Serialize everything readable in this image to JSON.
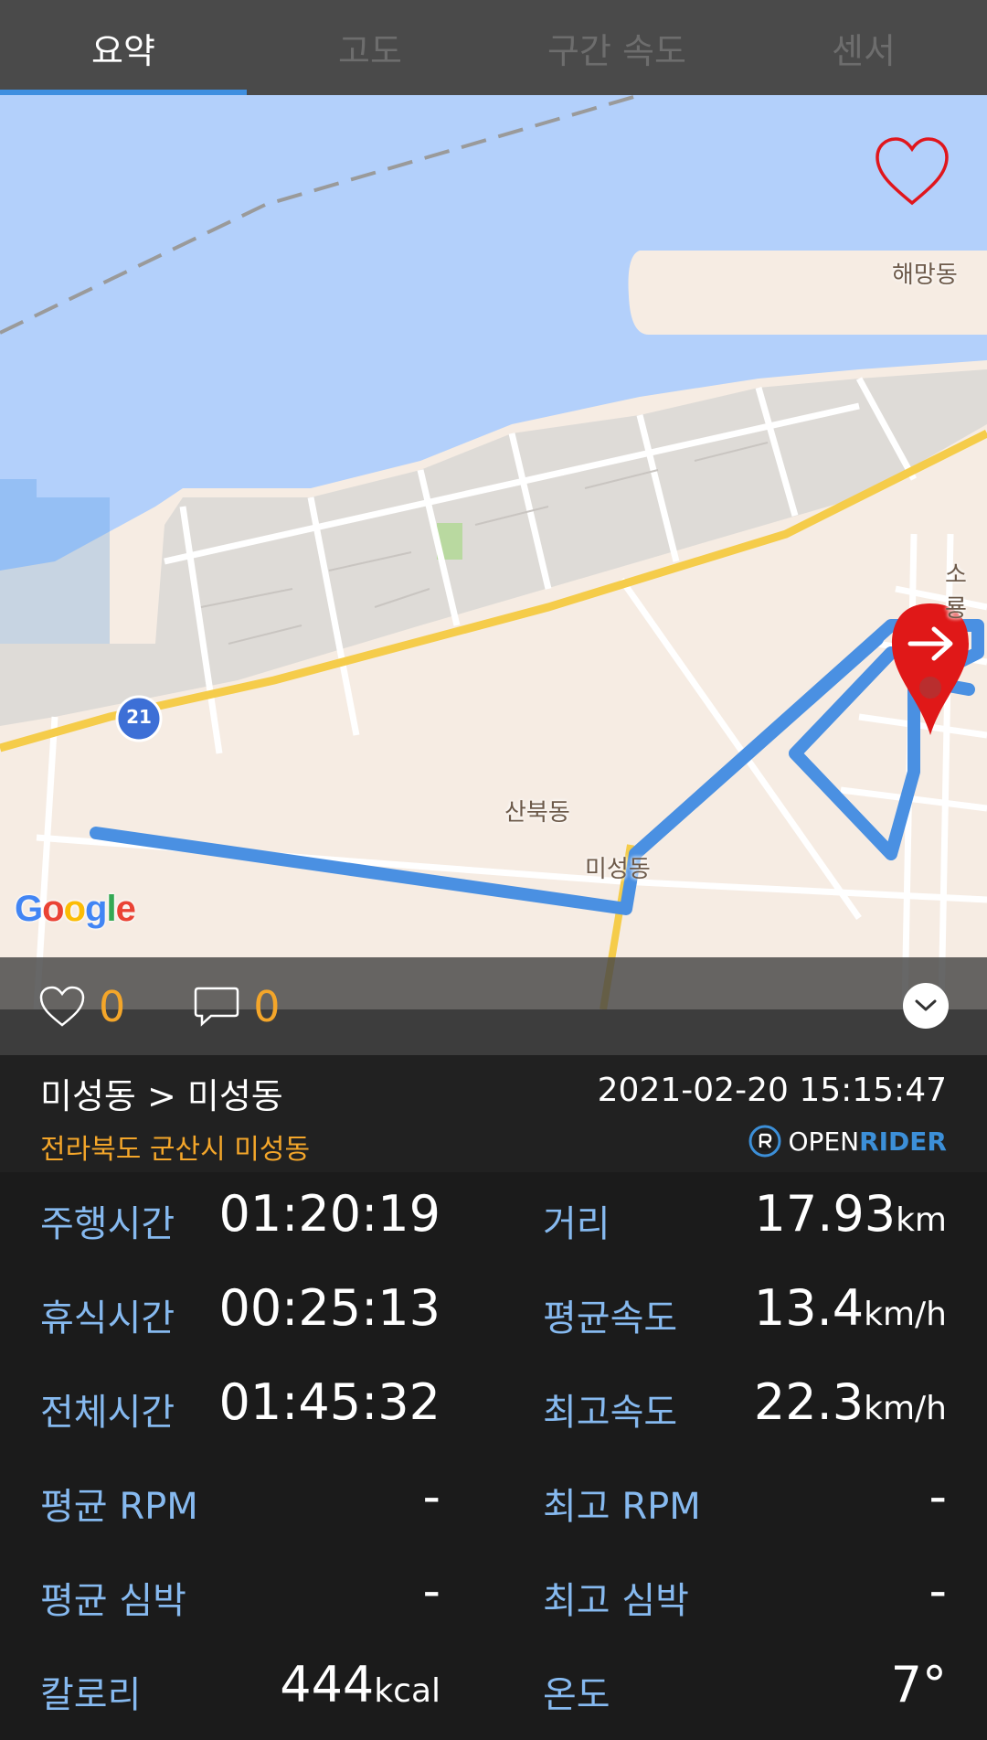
{
  "tabs": [
    {
      "label": "요약",
      "active": true
    },
    {
      "label": "고도",
      "active": false
    },
    {
      "label": "구간 속도",
      "active": false
    },
    {
      "label": "센서",
      "active": false
    }
  ],
  "map": {
    "labels": {
      "haemang": "해망동",
      "sanbuk": "산북동",
      "miseong": "미성동",
      "soryong": "소룡",
      "road_number": "21"
    },
    "provider_logo": {
      "G": "G",
      "o1": "o",
      "o2": "o",
      "g": "g",
      "l": "l",
      "e": "e"
    },
    "route_color": "#4a90e2",
    "marker_color": "#e01818"
  },
  "social": {
    "likes": "0",
    "comments": "0"
  },
  "route": {
    "title": "미성동 > 미성동",
    "subtitle": "전라북도 군산시 미성동",
    "datetime": "2021-02-20 15:15:47",
    "brand_open": "OPEN",
    "brand_rider": "RIDER"
  },
  "stats": [
    {
      "left_label": "주행시간",
      "left_value": "01:20:19",
      "left_unit": "",
      "right_label": "거리",
      "right_value": "17.93",
      "right_unit": "km"
    },
    {
      "left_label": "휴식시간",
      "left_value": "00:25:13",
      "left_unit": "",
      "right_label": "평균속도",
      "right_value": "13.4",
      "right_unit": "km/h"
    },
    {
      "left_label": "전체시간",
      "left_value": "01:45:32",
      "left_unit": "",
      "right_label": "최고속도",
      "right_value": "22.3",
      "right_unit": "km/h"
    },
    {
      "left_label": "평균 RPM",
      "left_value": "-",
      "left_unit": "",
      "right_label": "최고 RPM",
      "right_value": "-",
      "right_unit": ""
    },
    {
      "left_label": "평균 심박",
      "left_value": "-",
      "left_unit": "",
      "right_label": "최고 심박",
      "right_value": "-",
      "right_unit": ""
    },
    {
      "left_label": "칼로리",
      "left_value": "444",
      "left_unit": "kcal",
      "right_label": "온도",
      "right_value": "7°",
      "right_unit": ""
    }
  ]
}
